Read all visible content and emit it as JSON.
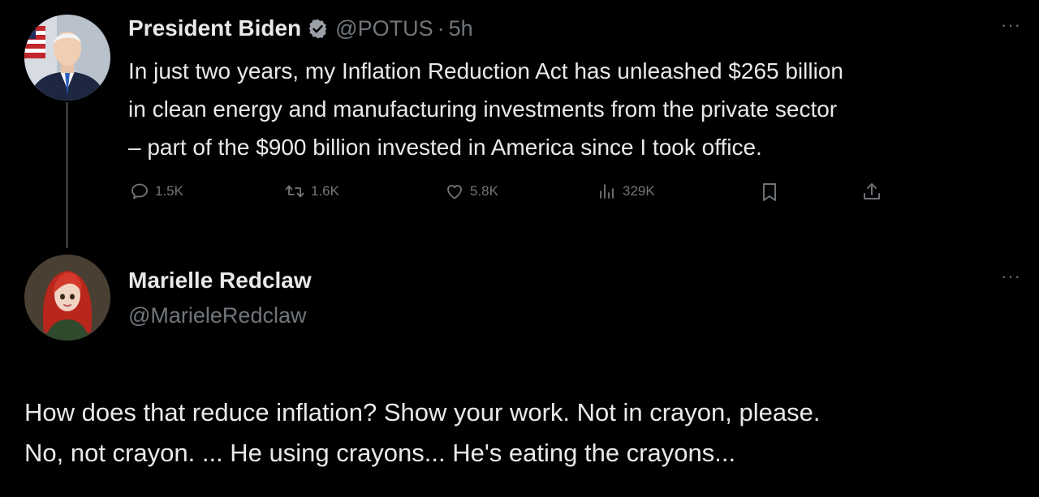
{
  "tweet": {
    "author_name": "President Biden",
    "handle": "@POTUS",
    "separator": "·",
    "time": "5h",
    "more_label": "···",
    "text_lines": [
      "In just two years, my Inflation Reduction Act has unleashed $265 billion",
      "in clean energy and manufacturing investments from the private sector",
      "– part of the $900 billion invested in America since I took office."
    ],
    "actions": {
      "replies": "1.5K",
      "retweets": "1.6K",
      "likes": "5.8K",
      "views": "329K"
    },
    "icons": [
      "reply-icon",
      "retweet-icon",
      "like-icon",
      "views-icon",
      "bookmark-icon",
      "share-icon",
      "verified-badge-icon"
    ]
  },
  "reply": {
    "author_name": "Marielle Redclaw",
    "handle": "@MarieleRedclaw",
    "more_label": "···",
    "text_lines": [
      "How does that reduce inflation? Show your work. Not in crayon, please.",
      "No, not crayon. ... He using crayons... He's eating the crayons..."
    ]
  },
  "colors": {
    "background": "#000000",
    "text_primary": "#e7e9ea",
    "text_secondary": "#71767b",
    "verified_badge": "#9aa0a6",
    "thread_line": "#333639"
  }
}
